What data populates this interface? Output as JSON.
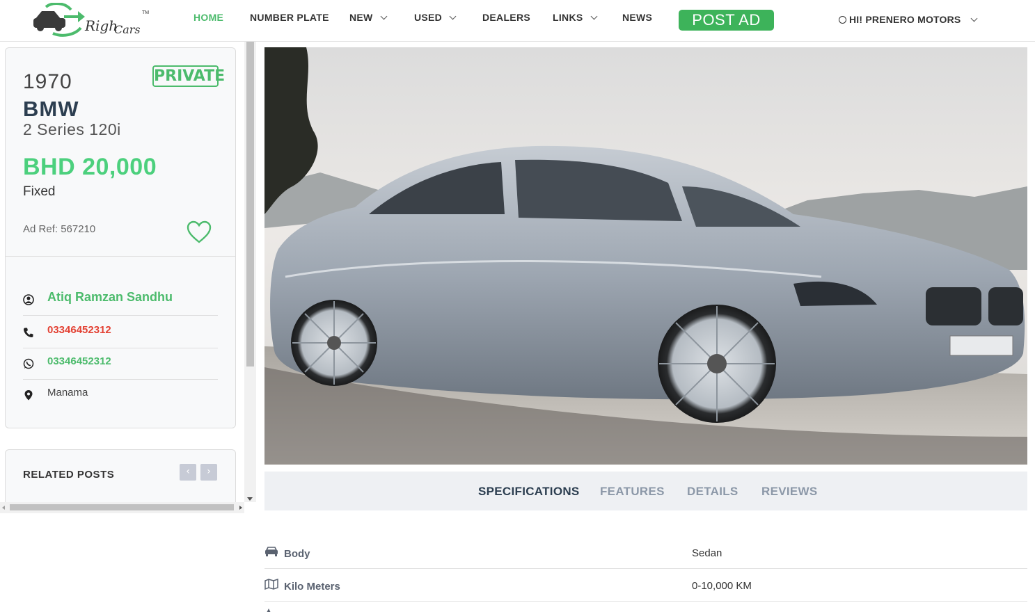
{
  "header": {
    "nav": [
      {
        "label": "HOME",
        "active": true,
        "dropdown": false
      },
      {
        "label": "NUMBER PLATE",
        "active": false,
        "dropdown": false
      },
      {
        "label": "NEW",
        "active": false,
        "dropdown": true
      },
      {
        "label": "USED",
        "active": false,
        "dropdown": true
      },
      {
        "label": "DEALERS",
        "active": false,
        "dropdown": false
      },
      {
        "label": "LINKS",
        "active": false,
        "dropdown": true
      },
      {
        "label": "NEWS",
        "active": false,
        "dropdown": false
      }
    ],
    "post_ad_label": "POST AD",
    "user_label": "HI! PRENERO MOTORS"
  },
  "listing": {
    "year": "1970",
    "badge": "PRIVATE",
    "make": "BMW",
    "model": "2 Series 120i",
    "price": "BHD 20,000",
    "price_type": "Fixed",
    "ad_ref": "Ad Ref: 567210"
  },
  "contact": {
    "name": "Atiq Ramzan Sandhu",
    "phone": "03346452312",
    "whatsapp": "03346452312",
    "location": "Manama"
  },
  "related": {
    "title": "RELATED POSTS",
    "prev": "‹",
    "next": "›"
  },
  "tabs": [
    {
      "label": "SPECIFICATIONS",
      "active": true
    },
    {
      "label": "FEATURES",
      "active": false
    },
    {
      "label": "DETAILS",
      "active": false
    },
    {
      "label": "REVIEWS",
      "active": false
    }
  ],
  "specs": [
    {
      "icon": "car-icon",
      "label": "Body",
      "value": "Sedan"
    },
    {
      "icon": "map-icon",
      "label": "Kilo Meters",
      "value": "0-10,000 KM"
    }
  ],
  "colors": {
    "accent_green": "#4cbb6c",
    "price_green": "#4cd07d",
    "post_ad_bg": "#3db35a",
    "phone_red": "#e34234",
    "dark_text": "#2c3e50"
  }
}
